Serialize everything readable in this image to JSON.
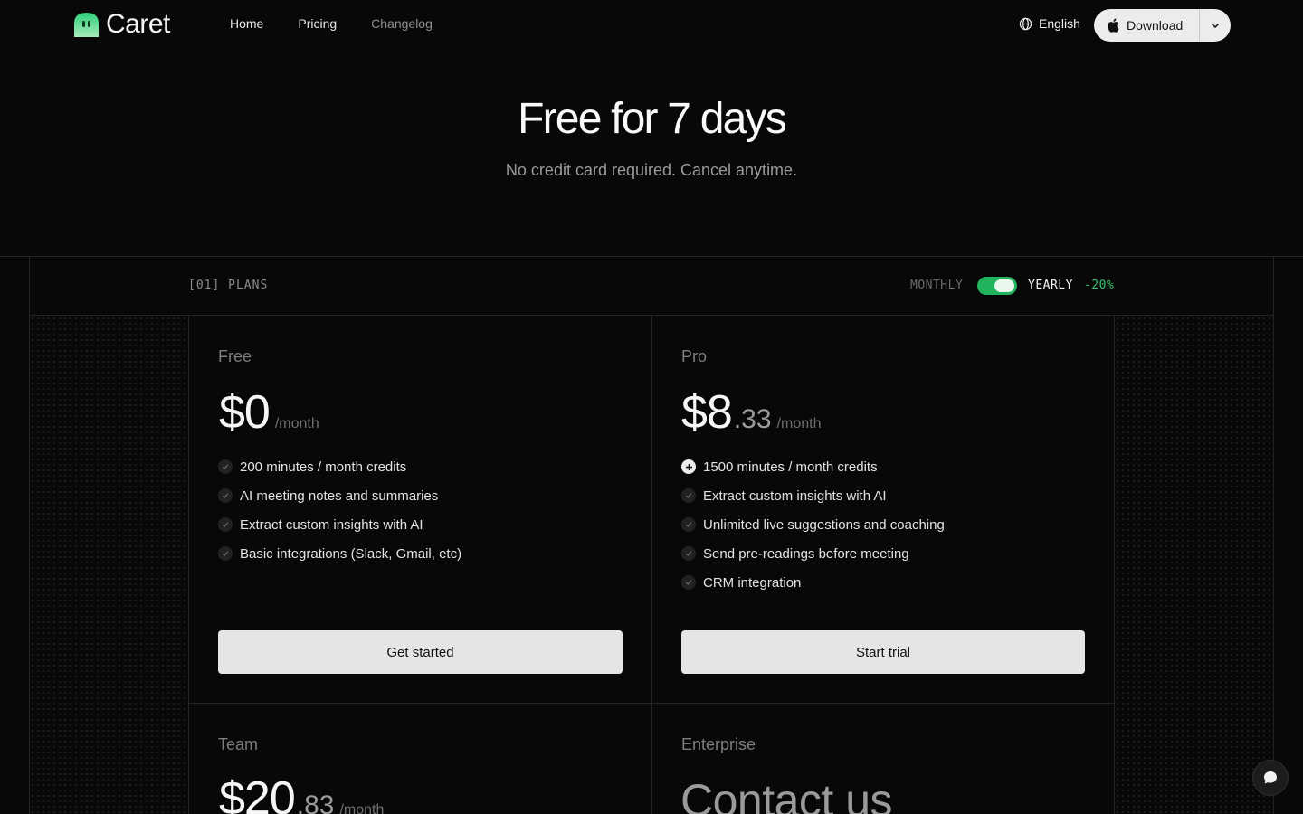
{
  "brand": {
    "name": "Caret",
    "accent": "#31c46c"
  },
  "nav": {
    "items": [
      {
        "label": "Home"
      },
      {
        "label": "Pricing"
      },
      {
        "label": "Changelog"
      }
    ]
  },
  "header": {
    "language": "English",
    "download_label": "Download"
  },
  "hero": {
    "title": "Free for 7 days",
    "subtitle": "No credit card required. Cancel anytime."
  },
  "plans": {
    "section_label": "[01] PLANS",
    "billing": {
      "monthly": "MONTHLY",
      "yearly": "YEARLY",
      "discount": "-20%",
      "yearly_selected": true
    },
    "free": {
      "name": "Free",
      "price": "$0",
      "unit": "/month",
      "features": [
        "200 minutes / month credits",
        "AI meeting notes and summaries",
        "Extract custom insights with AI",
        "Basic integrations (Slack, Gmail, etc)"
      ],
      "cta": "Get started"
    },
    "pro": {
      "name": "Pro",
      "price": "$8",
      "cents": ".33",
      "unit": "/month",
      "features": [
        "1500 minutes / month credits",
        "Extract custom insights with AI",
        "Unlimited live suggestions and coaching",
        "Send pre-readings before meeting",
        "CRM integration"
      ],
      "cta": "Start trial"
    },
    "team": {
      "name": "Team",
      "price": "$20",
      "cents": ".83",
      "unit": "/month"
    },
    "enterprise": {
      "name": "Enterprise",
      "price": "Contact us"
    }
  }
}
